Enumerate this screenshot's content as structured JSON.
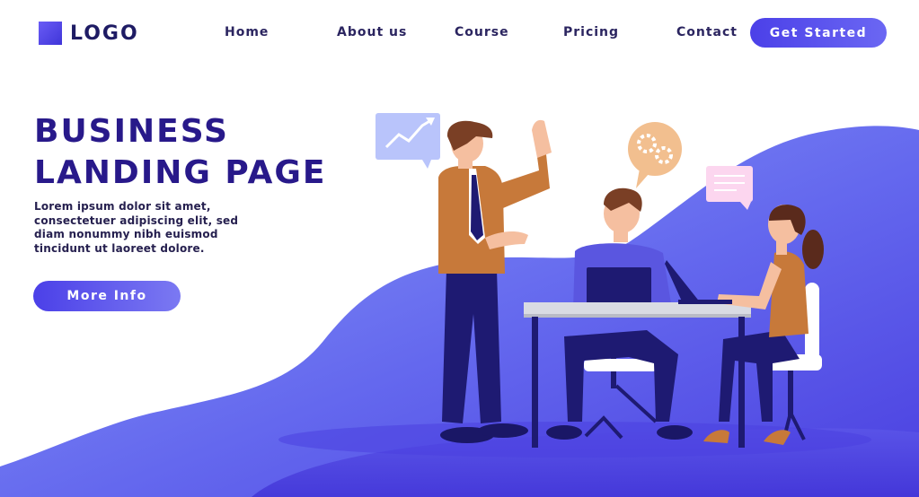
{
  "header": {
    "logo_text": "LOGO",
    "nav": [
      "Home",
      "About us",
      "Course",
      "Pricing",
      "Contact"
    ],
    "cta_label": "Get Started"
  },
  "hero": {
    "title_lines": [
      "BUSINESS",
      "LANDING PAGE"
    ],
    "body_lines": [
      "Lorem ipsum dolor sit amet,",
      "consectetuer adipiscing elit, sed",
      "diam nonummy nibh euismod",
      "tincidunt ut laoreet dolore."
    ],
    "button_label": "More Info"
  },
  "colors": {
    "accent": "#4b40e8",
    "title": "#28198a",
    "wave_light": "#7f86f5",
    "wave_dark": "#4a3fe0"
  },
  "illustration": {
    "icons": [
      "line-chart-bubble-icon",
      "gears-bubble-icon",
      "message-bubble-icon"
    ]
  }
}
